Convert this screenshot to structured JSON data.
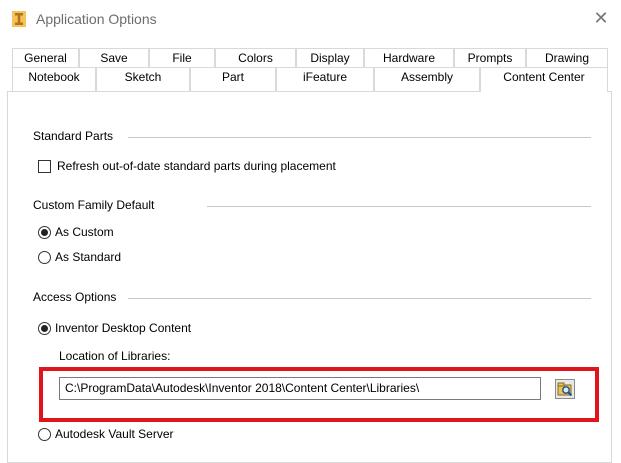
{
  "window": {
    "title": "Application Options",
    "close_glyph": "✕"
  },
  "tabs": {
    "row_back": [
      "General",
      "Save",
      "File",
      "Colors",
      "Display",
      "Hardware",
      "Prompts",
      "Drawing"
    ],
    "row_front": [
      "Notebook",
      "Sketch",
      "Part",
      "iFeature",
      "Assembly",
      "Content Center"
    ],
    "selected": "Content Center"
  },
  "standard_parts": {
    "heading": "Standard Parts",
    "refresh_label": "Refresh out-of-date standard parts during placement",
    "refresh_checked": false
  },
  "custom_family_default": {
    "heading": "Custom Family Default",
    "options": [
      "As Custom",
      "As Standard"
    ],
    "selected": "As Custom"
  },
  "access_options": {
    "heading": "Access Options",
    "desktop_label": "Inventor Desktop Content",
    "location_label": "Location of Libraries:",
    "location_value": "C:\\ProgramData\\Autodesk\\Inventor 2018\\Content Center\\Libraries\\",
    "vault_label": "Autodesk Vault Server",
    "selected": "Inventor Desktop Content"
  },
  "icons": {
    "app": "inventor-app-icon",
    "browse": "browse-folder-icon",
    "close": "close-icon"
  },
  "colors": {
    "highlight": "#e0141b",
    "app_icon": "#d9952a"
  }
}
